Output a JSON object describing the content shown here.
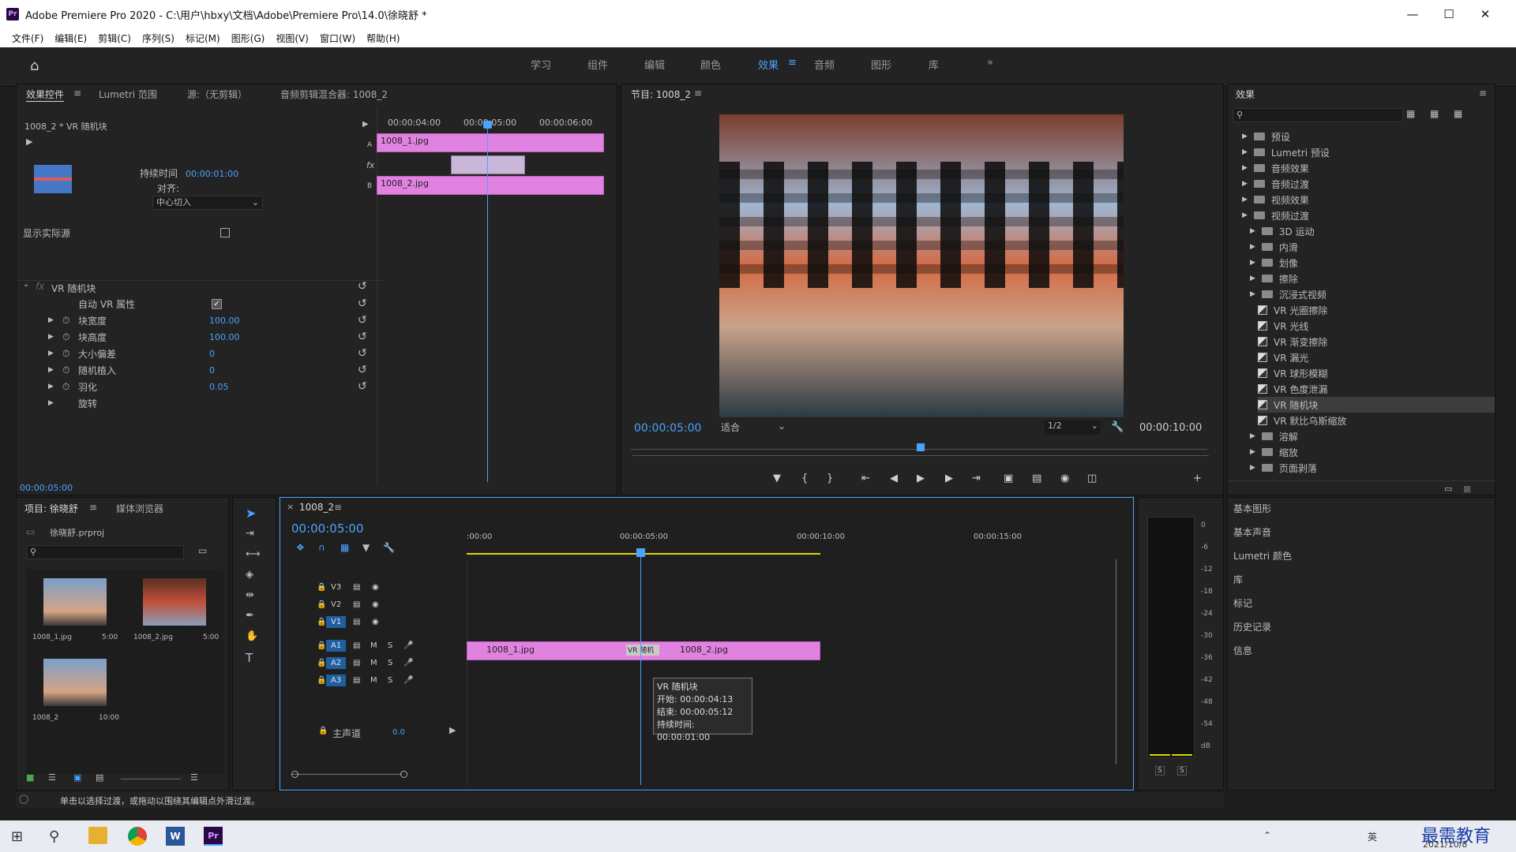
{
  "title_bar": {
    "app_icon": "Pr",
    "title": "Adobe Premiere Pro 2020 - C:\\用户\\hbxy\\文档\\Adobe\\Premiere Pro\\14.0\\徐晓舒 *"
  },
  "menu": [
    "文件(F)",
    "编辑(E)",
    "剪辑(C)",
    "序列(S)",
    "标记(M)",
    "图形(G)",
    "视图(V)",
    "窗口(W)",
    "帮助(H)"
  ],
  "workspaces": {
    "tabs": [
      "学习",
      "组件",
      "编辑",
      "颜色",
      "效果",
      "音频",
      "图形",
      "库"
    ],
    "active": "效果",
    "more": "»"
  },
  "effect_controls": {
    "tabs": [
      "效果控件",
      "Lumetri 范围",
      "源:（无剪辑）",
      "音频剪辑混合器: 1008_2"
    ],
    "clip_path": "1008_2 * VR 随机块",
    "ruler": [
      "00:00:04:00",
      "00:00:05:00",
      "00:00:06:00"
    ],
    "track_a_clip": "1008_1.jpg",
    "track_b_clip": "1008_2.jpg",
    "label_a": "A",
    "label_b": "B",
    "label_fx": "fx",
    "duration_label": "持续时间",
    "duration_value": "00:00:01:00",
    "align_label": "对齐:",
    "align_value": "中心切入",
    "show_source": "显示实际源",
    "effect_name": "VR 随机块",
    "props": [
      {
        "label": "自动 VR 属性",
        "value": ""
      },
      {
        "label": "块宽度",
        "value": "100.00"
      },
      {
        "label": "块高度",
        "value": "100.00"
      },
      {
        "label": "大小偏差",
        "value": "0"
      },
      {
        "label": "随机植入",
        "value": "0"
      },
      {
        "label": "羽化",
        "value": "0.05"
      },
      {
        "label": "旋转",
        "value": ""
      }
    ],
    "timecode": "00:00:05:00"
  },
  "program": {
    "tab": "节目: 1008_2",
    "timecode": "00:00:05:00",
    "fit": "适合",
    "resolution": "1/2",
    "duration": "00:00:10:00"
  },
  "effects_panel": {
    "title": "效果",
    "items": [
      {
        "label": "预设",
        "level": 0,
        "type": "folder"
      },
      {
        "label": "Lumetri 预设",
        "level": 0,
        "type": "folder"
      },
      {
        "label": "音频效果",
        "level": 0,
        "type": "folder"
      },
      {
        "label": "音频过渡",
        "level": 0,
        "type": "folder"
      },
      {
        "label": "视频效果",
        "level": 0,
        "type": "folder"
      },
      {
        "label": "视频过渡",
        "level": 0,
        "type": "folder"
      },
      {
        "label": "3D 运动",
        "level": 1,
        "type": "folder"
      },
      {
        "label": "内滑",
        "level": 1,
        "type": "folder"
      },
      {
        "label": "划像",
        "level": 1,
        "type": "folder"
      },
      {
        "label": "擦除",
        "level": 1,
        "type": "folder"
      },
      {
        "label": "沉浸式视频",
        "level": 1,
        "type": "folder"
      },
      {
        "label": "VR 光圈擦除",
        "level": 2,
        "type": "fx"
      },
      {
        "label": "VR 光线",
        "level": 2,
        "type": "fx"
      },
      {
        "label": "VR 渐变擦除",
        "level": 2,
        "type": "fx"
      },
      {
        "label": "VR 漏光",
        "level": 2,
        "type": "fx"
      },
      {
        "label": "VR 球形模糊",
        "level": 2,
        "type": "fx"
      },
      {
        "label": "VR 色度泄漏",
        "level": 2,
        "type": "fx"
      },
      {
        "label": "VR 随机块",
        "level": 2,
        "type": "fx"
      },
      {
        "label": "VR 默比乌斯缩放",
        "level": 2,
        "type": "fx"
      },
      {
        "label": "溶解",
        "level": 1,
        "type": "folder"
      },
      {
        "label": "缩放",
        "level": 1,
        "type": "folder"
      },
      {
        "label": "页面剥落",
        "level": 1,
        "type": "folder"
      }
    ],
    "side_panels": [
      "基本图形",
      "基本声音",
      "Lumetri 颜色",
      "库",
      "标记",
      "历史记录",
      "信息"
    ]
  },
  "project": {
    "tabs": [
      "项目: 徐晓舒",
      "媒体浏览器"
    ],
    "file": "徐晓舒.prproj",
    "items": [
      {
        "name": "1008_1.jpg",
        "dur": "5:00"
      },
      {
        "name": "1008_2.jpg",
        "dur": "5:00"
      },
      {
        "name": "1008_2",
        "dur": "10:00"
      }
    ]
  },
  "timeline": {
    "tab": "1008_2",
    "timecode": "00:00:05:00",
    "ruler": [
      ":00:00",
      "00:00:05:00",
      "00:00:10:00",
      "00:00:15:00"
    ],
    "tracks": [
      "V3",
      "V2",
      "V1",
      "A1",
      "A2",
      "A3"
    ],
    "track_m": "M",
    "track_s": "S",
    "master": "主声道",
    "master_value": "0.0",
    "clip1": "1008_1.jpg",
    "clip2": "1008_2.jpg",
    "transition": "VR 随机",
    "tooltip": [
      "VR 随机块",
      "开始: 00:00:04:13",
      "结束: 00:00:05:12",
      "持续时间: 00:00:01:00"
    ]
  },
  "meter": {
    "scale": [
      "0",
      "-6",
      "-12",
      "-18",
      "-24",
      "-30",
      "-36",
      "-42",
      "-48",
      "-54",
      "dB"
    ],
    "solo": "S"
  },
  "status": "单击以选择过渡，或拖动以围绕其编辑点外滑过渡。",
  "tray": {
    "ime": "英",
    "date": "2021/10/8",
    "watermark": "最需教育"
  },
  "colors": {
    "accent": "#4aa3ff",
    "clip": "#e282e0",
    "panel": "#232323"
  }
}
